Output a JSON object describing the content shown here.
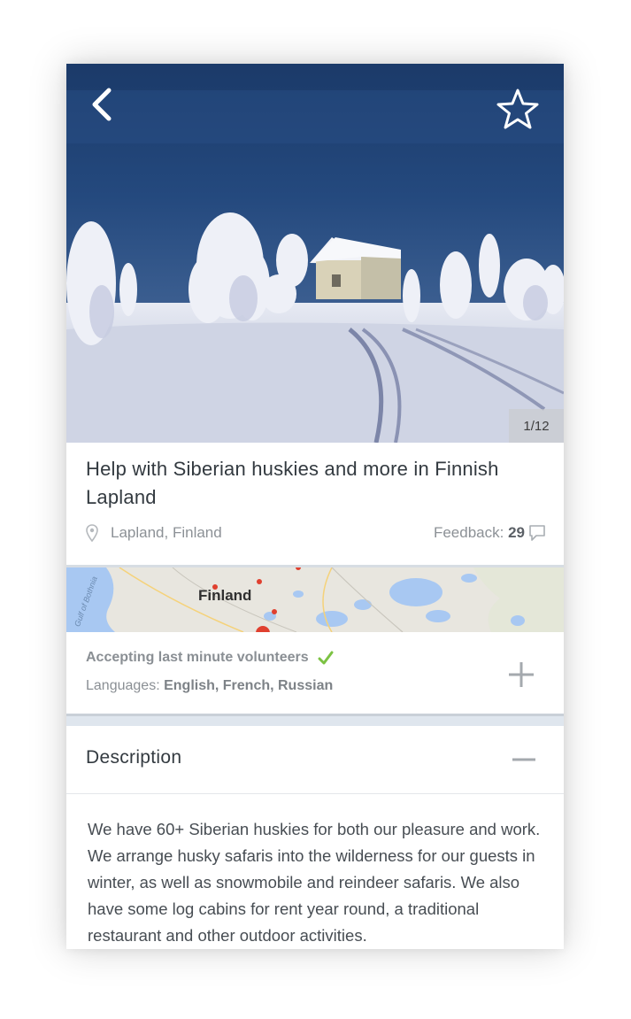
{
  "hero": {
    "image_counter": "1/12",
    "back_icon": "chevron-left-icon",
    "favorite_icon": "star-outline-icon"
  },
  "listing": {
    "title": "Help with Siberian huskies and more in Finnish Lapland",
    "location": "Lapland, Finland",
    "feedback_label": "Feedback:",
    "feedback_count": "29"
  },
  "map": {
    "label": "Finland",
    "side_label": "Gulf of Bothnia"
  },
  "details": {
    "accepting": "Accepting last minute volunteers",
    "languages_label": "Languages:",
    "languages": "English, French, Russian"
  },
  "description": {
    "heading": "Description",
    "text": "We have 60+ Siberian huskies for both our pleasure and work. We arrange husky safaris into the wilderness for our guests in winter, as well as snowmobile and reindeer safaris. We also have some log cabins for rent year round, a traditional restaurant and other outdoor activities."
  },
  "colors": {
    "accent_check": "#7cc243",
    "text_dark": "#333a40",
    "text_muted": "#8c9196"
  }
}
